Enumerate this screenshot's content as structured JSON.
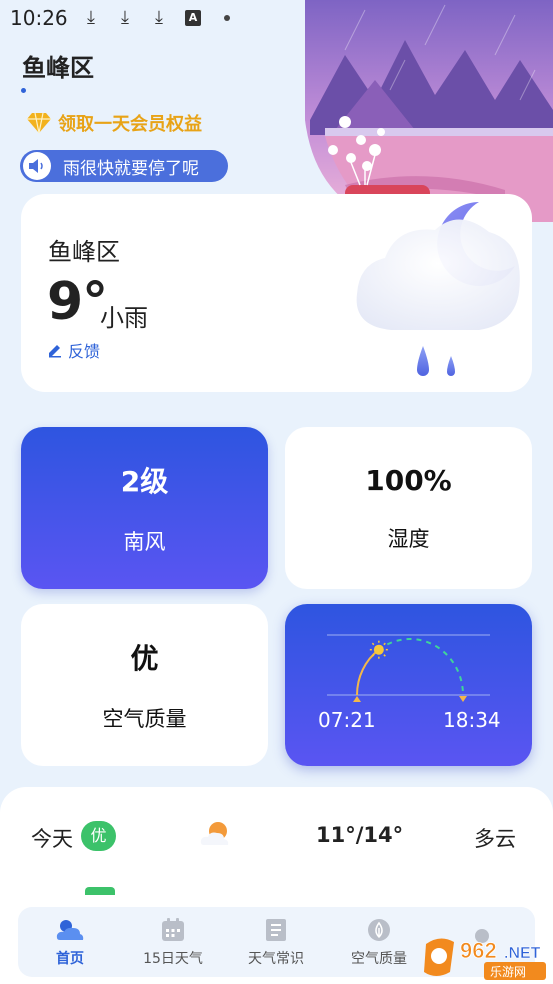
{
  "status_bar": {
    "time": "10:26",
    "icons": [
      "download-icon",
      "download-icon",
      "download-icon",
      "a-icon",
      "dot-icon",
      "wifi-icon",
      "signal-icon",
      "battery-icon"
    ]
  },
  "header": {
    "city": "鱼峰区",
    "vip_label": "领取一天会员权益",
    "notice": "雨很快就要停了呢"
  },
  "current": {
    "city": "鱼峰区",
    "temperature": "9°",
    "condition": "小雨",
    "feedback_label": "反馈",
    "icon": "cloud-moon-rain-icon"
  },
  "tiles": {
    "wind": {
      "value": "2级",
      "label": "南风"
    },
    "humidity": {
      "value": "100%",
      "label": "湿度"
    },
    "air": {
      "value": "优",
      "label": "空气质量"
    },
    "sun": {
      "sunrise": "07:21",
      "sunset": "18:34",
      "elapsed_fraction": 0.3
    }
  },
  "forecast": {
    "day": "今天",
    "aqi_badge": "优",
    "range": "11°/14°",
    "condition": "多云",
    "icon": "partly-cloudy-icon"
  },
  "nav": [
    {
      "label": "首页",
      "icon": "home-weather-icon",
      "active": true
    },
    {
      "label": "15日天气",
      "icon": "calendar-icon",
      "active": false
    },
    {
      "label": "天气常识",
      "icon": "book-icon",
      "active": false
    },
    {
      "label": "空气质量",
      "icon": "leaf-icon",
      "active": false
    },
    {
      "label": "",
      "icon": "profile-icon",
      "active": false
    }
  ],
  "colors": {
    "accent": "#2f63d8",
    "tile_gradient_top": "#2e55e0",
    "tile_gradient_bottom": "#5a55f2",
    "vip_gold": "#e8a317",
    "badge_green": "#3cc26a",
    "background": "#e9f2fc"
  }
}
